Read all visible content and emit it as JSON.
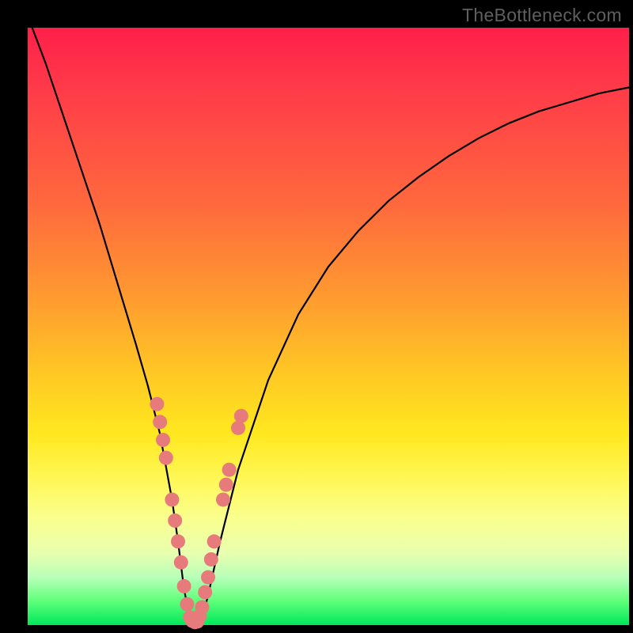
{
  "watermark": "TheBottleneck.com",
  "chart_data": {
    "type": "line",
    "title": "",
    "xlabel": "",
    "ylabel": "",
    "xlim": [
      0,
      100
    ],
    "ylim": [
      0,
      100
    ],
    "series": [
      {
        "name": "bottleneck-curve",
        "x": [
          0,
          3,
          6,
          9,
          12,
          15,
          18,
          20,
          22,
          24,
          25,
          26,
          27,
          28,
          29,
          30,
          32,
          35,
          40,
          45,
          50,
          55,
          60,
          65,
          70,
          75,
          80,
          85,
          90,
          95,
          100
        ],
        "values": [
          102,
          94,
          85,
          76,
          67,
          57,
          47,
          40,
          32,
          21,
          14,
          6,
          1,
          0,
          1,
          5,
          14,
          26,
          41,
          52,
          60,
          66,
          71,
          75,
          78.5,
          81.5,
          84,
          86,
          87.5,
          89,
          90
        ]
      }
    ],
    "markers": {
      "name": "highlight-dots",
      "color": "#e77b7b",
      "points_xy": [
        [
          21.5,
          37.0
        ],
        [
          22.0,
          34.0
        ],
        [
          22.5,
          31.0
        ],
        [
          23.0,
          28.0
        ],
        [
          24.0,
          21.0
        ],
        [
          24.5,
          17.5
        ],
        [
          25.0,
          14.0
        ],
        [
          25.5,
          10.5
        ],
        [
          26.0,
          6.5
        ],
        [
          26.5,
          3.5
        ],
        [
          27.0,
          1.3
        ],
        [
          27.4,
          0.7
        ],
        [
          27.8,
          0.5
        ],
        [
          28.2,
          0.6
        ],
        [
          28.6,
          1.5
        ],
        [
          29.0,
          3.0
        ],
        [
          29.5,
          5.5
        ],
        [
          30.0,
          8.0
        ],
        [
          30.5,
          11.0
        ],
        [
          31.0,
          14.0
        ],
        [
          32.5,
          21.0
        ],
        [
          33.0,
          23.5
        ],
        [
          33.5,
          26.0
        ],
        [
          35.0,
          33.0
        ],
        [
          35.5,
          35.0
        ]
      ]
    },
    "colors": {
      "curve": "#000000",
      "marker": "#e77b7b",
      "frame": "#000000",
      "gradient_top": "#ff1f4a",
      "gradient_bottom": "#00e85a"
    }
  }
}
